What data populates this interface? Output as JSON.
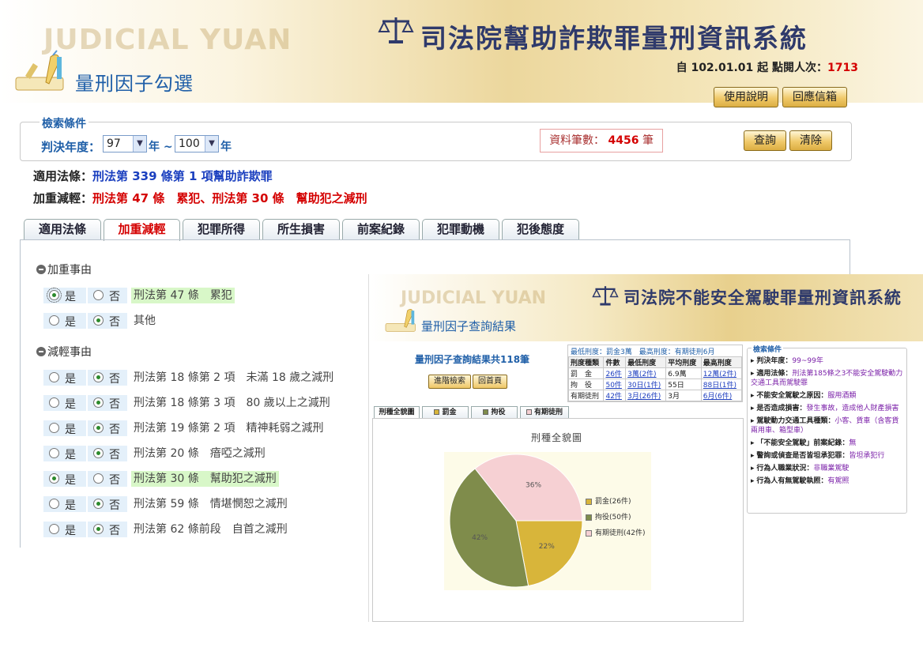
{
  "header": {
    "ghost_text": "JUDICIAL YUAN",
    "title": "司法院幫助詐欺罪量刑資訊系統",
    "subtitle": "量刑因子勾選",
    "visit_prefix": "自 102.01.01 起 點閱人次：",
    "visit_count": "1713",
    "manual_button": "使用說明",
    "mailbox_button": "回應信箱"
  },
  "criteria": {
    "legend": "檢索條件",
    "year_label": "判決年度：",
    "year_from": "97",
    "year_to": "100",
    "year_sep": "年 ~",
    "year_unit": "年",
    "count_label": "資料筆數：",
    "count_value": "4456",
    "count_unit": "筆",
    "query_button": "查詢",
    "clear_button": "清除"
  },
  "laws": {
    "applicable_label": "適用法條：",
    "applicable_value": "刑法第 339 條第 1 項幫助詐欺罪",
    "aggravate_label": "加重減輕：",
    "aggravate_value": "刑法第 47 條　累犯、刑法第 30 條　幫助犯之減刑"
  },
  "tabs": [
    "適用法條",
    "加重減輕",
    "犯罪所得",
    "所生損害",
    "前案紀錄",
    "犯罪動機",
    "犯後態度"
  ],
  "active_tab": "加重減輕",
  "factors": {
    "yes": "是",
    "no": "否",
    "aggravating_title": "加重事由",
    "aggravating": [
      {
        "text": "刑法第 47 條　累犯",
        "selected": "yes"
      },
      {
        "text": "其他",
        "selected": "no"
      }
    ],
    "mitigating_title": "減輕事由",
    "mitigating": [
      {
        "text": "刑法第 18 條第 2 項　未滿 18 歲之減刑",
        "selected": "no"
      },
      {
        "text": "刑法第 18 條第 3 項　80 歲以上之減刑",
        "selected": "no"
      },
      {
        "text": "刑法第 19 條第 2 項　精神耗弱之減刑",
        "selected": "no"
      },
      {
        "text": "刑法第 20 條　瘖啞之減刑",
        "selected": "no"
      },
      {
        "text": "刑法第 30 條　幫助犯之減刑",
        "selected": "yes"
      },
      {
        "text": "刑法第 59 條　情堪憫恕之減刑",
        "selected": "no"
      },
      {
        "text": "刑法第 62 條前段　自首之減刑",
        "selected": "no"
      }
    ]
  },
  "overlay": {
    "ghost_text": "JUDICIAL YUAN",
    "title": "司法院不能安全駕駛罪量刑資訊系統",
    "subtitle": "量刑因子查詢結果",
    "result_title": "量刑因子查詢結果共118筆",
    "advanced_button": "進階檢索",
    "home_button": "回首頁",
    "stats_caption": "最低刑度：罰金3萬　最高刑度：有期徒刑6月",
    "stats_headers": [
      "刑度種類",
      "件數",
      "最低刑度",
      "平均刑度",
      "最高刑度"
    ],
    "stats_rows": [
      [
        "罰　金",
        "26件",
        "3萬(2件)",
        "6.9萬",
        "12萬(2件)"
      ],
      [
        "拘　役",
        "50件",
        "30日(1件)",
        "55日",
        "88日(1件)"
      ],
      [
        "有期徒刑",
        "42件",
        "3月(26件)",
        "3月",
        "6月(6件)"
      ]
    ],
    "criteria_legend": "檢索條件",
    "criteria_items": [
      {
        "k": "判決年度：",
        "v": "99~99年"
      },
      {
        "k": "適用法條：",
        "v": "刑法第185條之3不能安全駕駛動力交通工具而駕駛罪"
      },
      {
        "k": "不能安全駕駛之原因：",
        "v": "服用酒類"
      },
      {
        "k": "是否造成損害：",
        "v": "發生事故，造成他人財產損害"
      },
      {
        "k": "駕駛動力交通工具種類：",
        "v": "小客、貨車（含客貨兩用車、箱型車）"
      },
      {
        "k": "「不能安全駕駛」前案紀錄：",
        "v": "無"
      },
      {
        "k": "警詢或偵查是否皆坦承犯罪：",
        "v": "皆坦承犯行"
      },
      {
        "k": "行為人職業狀況：",
        "v": "非職業駕駛"
      },
      {
        "k": "行為人有無駕駛執照：",
        "v": "有駕照"
      }
    ],
    "tabs": [
      "刑種全貌圖",
      "罰金",
      "拘役",
      "有期徒刑"
    ],
    "tab_colors": [
      "",
      "#d8b53a",
      "#7f8c4b",
      "#f6d0d3"
    ]
  },
  "chart_data": {
    "type": "pie",
    "title": "刑種全貌圖",
    "categories": [
      "罰金(26件)",
      "拘役(50件)",
      "有期徒刑(42件)"
    ],
    "values": [
      26,
      50,
      42
    ],
    "percent_labels": [
      "22%",
      "42%",
      "36%"
    ],
    "colors": [
      "#d8b53a",
      "#7f8c4b",
      "#f6d0d3"
    ],
    "legend_position": "right"
  }
}
